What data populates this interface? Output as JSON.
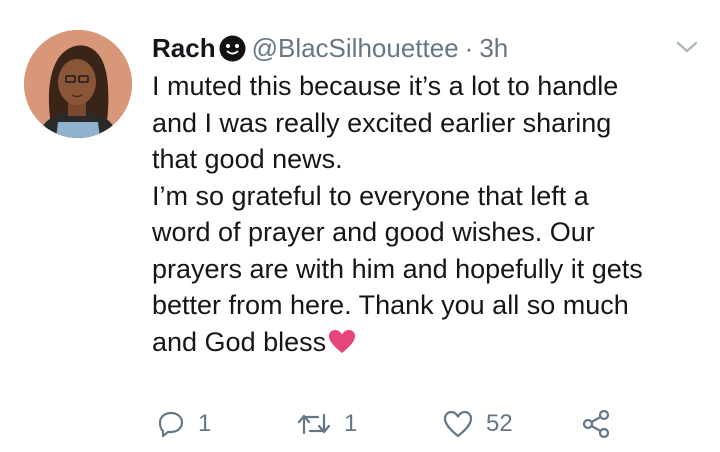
{
  "tweet": {
    "author_name": "Rach",
    "author_handle": "@BlacSilhouettee",
    "separator": "·",
    "time": "3h",
    "text_lines": [
      "I muted this because it’s a lot to handle",
      "and I was really excited earlier sharing",
      "that good news.",
      "I’m so grateful to everyone that left a",
      "word of prayer and good wishes. Our",
      "prayers are with him and hopefully it gets",
      "better from here. Thank you all so much",
      "and God bless"
    ],
    "icons": {
      "name_emoji": "smiling-emoji-icon",
      "caret": "chevron-down-icon",
      "end_emoji": "pink-heart-emoji-icon"
    }
  },
  "actions": {
    "reply_count": "1",
    "retweet_count": "1",
    "like_count": "52"
  },
  "colors": {
    "text": "#14171a",
    "muted": "#657786",
    "heart": "#e8447c",
    "avatar_bg": "#d9977a"
  }
}
